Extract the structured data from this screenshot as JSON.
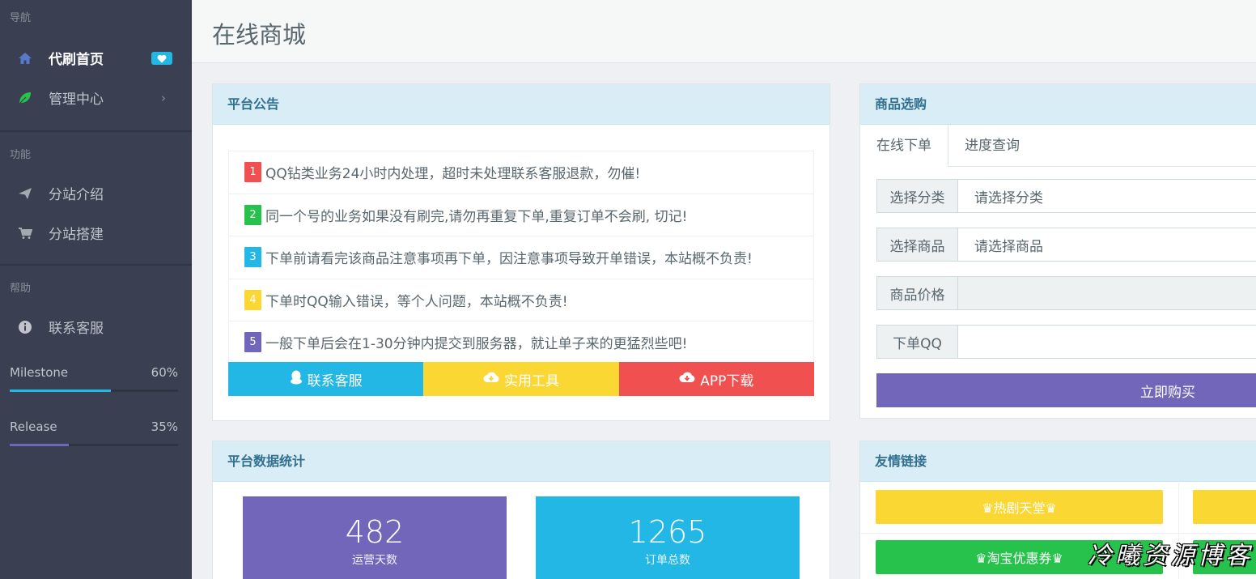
{
  "sidebar": {
    "sections": [
      {
        "header": "导航"
      },
      {
        "header": "功能"
      },
      {
        "header": "帮助"
      }
    ],
    "items": [
      {
        "label": "代刷首页",
        "icon": "home-icon",
        "active": true,
        "badge": "heart-icon"
      },
      {
        "label": "管理中心",
        "icon": "leaf-icon"
      },
      {
        "label": "分站介绍",
        "icon": "paper-plane-icon"
      },
      {
        "label": "分站搭建",
        "icon": "cart-icon"
      },
      {
        "label": "联系客服",
        "icon": "info-circle-icon"
      }
    ],
    "progress": [
      {
        "label": "Milestone",
        "value": "60%",
        "fraction": 0.6,
        "color": "#23b7e5"
      },
      {
        "label": "Release",
        "value": "35%",
        "fraction": 0.35,
        "color": "#7266ba"
      }
    ]
  },
  "header": {
    "title": "在线商城"
  },
  "notice_panel": {
    "title": "平台公告",
    "items": [
      {
        "num": "1",
        "color": "#f05050",
        "text": "QQ钻类业务24小时内处理，超时未处理联系客服退款，勿催!"
      },
      {
        "num": "2",
        "color": "#27c24c",
        "text": "同一个号的业务如果没有刷完,请勿再重复下单,重复订单不会刷, 切记!"
      },
      {
        "num": "3",
        "color": "#23b7e5",
        "text": "下单前请看完该商品注意事项再下单，因注意事项导致开单错误，本站概不负责!"
      },
      {
        "num": "4",
        "color": "#fad733",
        "text": "下单时QQ输入错误，等个人问题，本站概不负责!"
      },
      {
        "num": "5",
        "color": "#7266ba",
        "text": "一般下单后会在1-30分钟内提交到服务器，就让单子来的更猛烈些吧!"
      }
    ],
    "buttons": [
      {
        "label": "联系客服",
        "icon": "qq-penguin-icon",
        "color": "#23b7e5"
      },
      {
        "label": "实用工具",
        "icon": "cloud-download-icon",
        "color": "#fad733"
      },
      {
        "label": "APP下载",
        "icon": "cloud-download-icon",
        "color": "#f05050"
      }
    ]
  },
  "shop_panel": {
    "title": "商品选购",
    "tabs": [
      {
        "label": "在线下单"
      },
      {
        "label": "进度查询"
      }
    ],
    "fields": [
      {
        "label": "选择分类",
        "value": "请选择分类"
      },
      {
        "label": "选择商品",
        "value": "请选择商品"
      },
      {
        "label": "商品价格",
        "value": ""
      },
      {
        "label": "下单QQ",
        "value": ""
      }
    ],
    "buy_label": "立即购买"
  },
  "stats_panel": {
    "title": "平台数据统计",
    "stats": [
      {
        "number": "482",
        "label": "运营天数",
        "color": "#7266ba"
      },
      {
        "number": "1265",
        "label": "订单总数",
        "color": "#23b7e5"
      }
    ]
  },
  "links_panel": {
    "title": "友情链接",
    "links": [
      {
        "label": "♛热剧天堂♛",
        "color": "#fad733"
      },
      {
        "label": "♛淘宝优惠券♛",
        "color": "#27c24c"
      }
    ]
  },
  "watermark": "冷曦资源博客"
}
